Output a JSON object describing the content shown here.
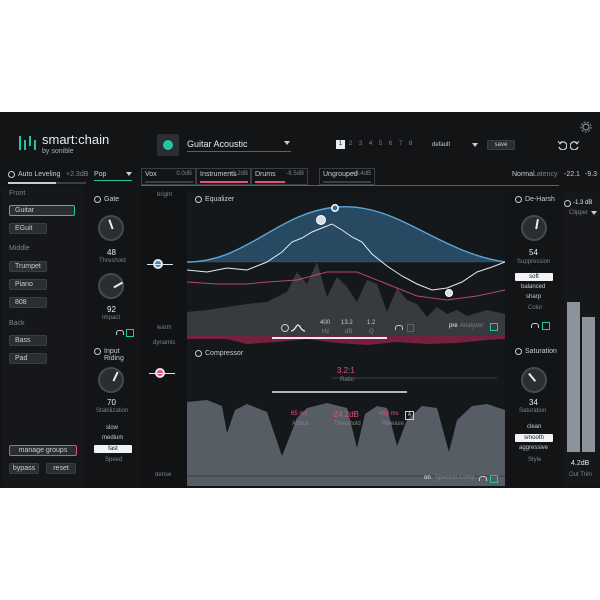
{
  "header": {
    "brand": "smart:chain",
    "by": "by",
    "company": "sonible",
    "preset_name": "Guitar Acoustic",
    "pages": [
      "1",
      "2",
      "3",
      "4",
      "5",
      "6",
      "7",
      "8"
    ],
    "preset_select": "default",
    "save_label": "save",
    "auto_leveling": "Auto Leveling",
    "auto_leveling_value": "+2.3dB",
    "genre": "Pop",
    "mode": "Normal",
    "latency_label": "Latency",
    "meter_l": "-22.1",
    "meter_r": "-9.3"
  },
  "groups": [
    {
      "label": "Vox",
      "value": "0.0dB"
    },
    {
      "label": "Instruments",
      "value": "+1.2dB"
    },
    {
      "label": "Drums",
      "value": "-9.5dB"
    },
    {
      "label": "Ungrouped",
      "value": "+3.4dB"
    }
  ],
  "sidebar": {
    "front_label": "Front",
    "front_items": [
      "Guitar",
      "EGuit"
    ],
    "middle_label": "Middle",
    "middle_items": [
      "Trumpet",
      "Piano",
      "808"
    ],
    "back_label": "Back",
    "back_items": [
      "Bass",
      "Pad"
    ],
    "manage_groups": "manage groups",
    "bypass": "bypass",
    "reset": "reset"
  },
  "gate": {
    "title": "Gate",
    "value": "48",
    "label": "Threshold",
    "impact_value": "92",
    "impact_label": "Impact"
  },
  "input_riding": {
    "title": "Input Riding",
    "value": "70",
    "label": "Stabilization",
    "speeds": [
      "slow",
      "medium",
      "fast"
    ],
    "speed_selected": "fast",
    "speed_label": "Speed"
  },
  "eq": {
    "title": "Equalizer",
    "axis_top": "bright",
    "axis_bottom": "warm",
    "hz_value": "400",
    "hz_label": "Hz",
    "db_value": "13.2",
    "db_label": "dB",
    "q_value": "1.2",
    "q_label": "Q",
    "pre": "pre",
    "analyzer": "Analyzer"
  },
  "compressor": {
    "title": "Compressor",
    "axis_top": "dynamic",
    "axis_bottom": "dense",
    "ratio_value": "3.2:1",
    "ratio_label": "Ratio",
    "attack_value": "65 ms",
    "attack_label": "Attack",
    "threshold_value": "-24.2dB",
    "threshold_label": "Threshold",
    "release_value": "450 ms",
    "release_label": "Release",
    "auto_badge": "A",
    "spectral_on": "on",
    "spectral_label": "Spectral Comp."
  },
  "deharsh": {
    "title": "De-Harsh",
    "value": "54",
    "label": "Suppression",
    "colors": [
      "soft",
      "balanced",
      "sharp"
    ],
    "color_selected": "soft",
    "color_label": "Color"
  },
  "saturation": {
    "title": "Saturation",
    "value": "34",
    "label": "Saturation",
    "styles": [
      "clean",
      "smooth",
      "aggressive"
    ],
    "style_selected": "smooth",
    "style_label": "Style"
  },
  "clipper": {
    "value": "-1.3 dB",
    "label": "Clipper",
    "out_value": "4.2dB",
    "out_label": "Out Trim"
  },
  "colors": {
    "accent": "#21c7a4",
    "pink": "#e0527a",
    "eq_blue": "#3f86b8"
  }
}
